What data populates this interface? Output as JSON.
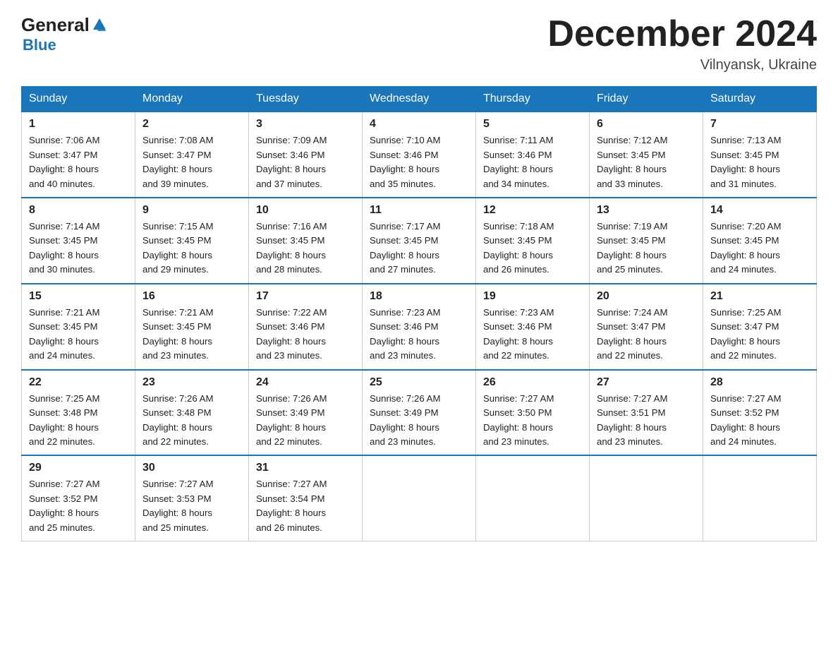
{
  "header": {
    "logo_general": "General",
    "logo_blue": "Blue",
    "month_title": "December 2024",
    "location": "Vilnyansk, Ukraine"
  },
  "days_of_week": [
    "Sunday",
    "Monday",
    "Tuesday",
    "Wednesday",
    "Thursday",
    "Friday",
    "Saturday"
  ],
  "weeks": [
    [
      {
        "day": "1",
        "sunrise": "Sunrise: 7:06 AM",
        "sunset": "Sunset: 3:47 PM",
        "daylight": "Daylight: 8 hours",
        "minutes": "and 40 minutes."
      },
      {
        "day": "2",
        "sunrise": "Sunrise: 7:08 AM",
        "sunset": "Sunset: 3:47 PM",
        "daylight": "Daylight: 8 hours",
        "minutes": "and 39 minutes."
      },
      {
        "day": "3",
        "sunrise": "Sunrise: 7:09 AM",
        "sunset": "Sunset: 3:46 PM",
        "daylight": "Daylight: 8 hours",
        "minutes": "and 37 minutes."
      },
      {
        "day": "4",
        "sunrise": "Sunrise: 7:10 AM",
        "sunset": "Sunset: 3:46 PM",
        "daylight": "Daylight: 8 hours",
        "minutes": "and 35 minutes."
      },
      {
        "day": "5",
        "sunrise": "Sunrise: 7:11 AM",
        "sunset": "Sunset: 3:46 PM",
        "daylight": "Daylight: 8 hours",
        "minutes": "and 34 minutes."
      },
      {
        "day": "6",
        "sunrise": "Sunrise: 7:12 AM",
        "sunset": "Sunset: 3:45 PM",
        "daylight": "Daylight: 8 hours",
        "minutes": "and 33 minutes."
      },
      {
        "day": "7",
        "sunrise": "Sunrise: 7:13 AM",
        "sunset": "Sunset: 3:45 PM",
        "daylight": "Daylight: 8 hours",
        "minutes": "and 31 minutes."
      }
    ],
    [
      {
        "day": "8",
        "sunrise": "Sunrise: 7:14 AM",
        "sunset": "Sunset: 3:45 PM",
        "daylight": "Daylight: 8 hours",
        "minutes": "and 30 minutes."
      },
      {
        "day": "9",
        "sunrise": "Sunrise: 7:15 AM",
        "sunset": "Sunset: 3:45 PM",
        "daylight": "Daylight: 8 hours",
        "minutes": "and 29 minutes."
      },
      {
        "day": "10",
        "sunrise": "Sunrise: 7:16 AM",
        "sunset": "Sunset: 3:45 PM",
        "daylight": "Daylight: 8 hours",
        "minutes": "and 28 minutes."
      },
      {
        "day": "11",
        "sunrise": "Sunrise: 7:17 AM",
        "sunset": "Sunset: 3:45 PM",
        "daylight": "Daylight: 8 hours",
        "minutes": "and 27 minutes."
      },
      {
        "day": "12",
        "sunrise": "Sunrise: 7:18 AM",
        "sunset": "Sunset: 3:45 PM",
        "daylight": "Daylight: 8 hours",
        "minutes": "and 26 minutes."
      },
      {
        "day": "13",
        "sunrise": "Sunrise: 7:19 AM",
        "sunset": "Sunset: 3:45 PM",
        "daylight": "Daylight: 8 hours",
        "minutes": "and 25 minutes."
      },
      {
        "day": "14",
        "sunrise": "Sunrise: 7:20 AM",
        "sunset": "Sunset: 3:45 PM",
        "daylight": "Daylight: 8 hours",
        "minutes": "and 24 minutes."
      }
    ],
    [
      {
        "day": "15",
        "sunrise": "Sunrise: 7:21 AM",
        "sunset": "Sunset: 3:45 PM",
        "daylight": "Daylight: 8 hours",
        "minutes": "and 24 minutes."
      },
      {
        "day": "16",
        "sunrise": "Sunrise: 7:21 AM",
        "sunset": "Sunset: 3:45 PM",
        "daylight": "Daylight: 8 hours",
        "minutes": "and 23 minutes."
      },
      {
        "day": "17",
        "sunrise": "Sunrise: 7:22 AM",
        "sunset": "Sunset: 3:46 PM",
        "daylight": "Daylight: 8 hours",
        "minutes": "and 23 minutes."
      },
      {
        "day": "18",
        "sunrise": "Sunrise: 7:23 AM",
        "sunset": "Sunset: 3:46 PM",
        "daylight": "Daylight: 8 hours",
        "minutes": "and 23 minutes."
      },
      {
        "day": "19",
        "sunrise": "Sunrise: 7:23 AM",
        "sunset": "Sunset: 3:46 PM",
        "daylight": "Daylight: 8 hours",
        "minutes": "and 22 minutes."
      },
      {
        "day": "20",
        "sunrise": "Sunrise: 7:24 AM",
        "sunset": "Sunset: 3:47 PM",
        "daylight": "Daylight: 8 hours",
        "minutes": "and 22 minutes."
      },
      {
        "day": "21",
        "sunrise": "Sunrise: 7:25 AM",
        "sunset": "Sunset: 3:47 PM",
        "daylight": "Daylight: 8 hours",
        "minutes": "and 22 minutes."
      }
    ],
    [
      {
        "day": "22",
        "sunrise": "Sunrise: 7:25 AM",
        "sunset": "Sunset: 3:48 PM",
        "daylight": "Daylight: 8 hours",
        "minutes": "and 22 minutes."
      },
      {
        "day": "23",
        "sunrise": "Sunrise: 7:26 AM",
        "sunset": "Sunset: 3:48 PM",
        "daylight": "Daylight: 8 hours",
        "minutes": "and 22 minutes."
      },
      {
        "day": "24",
        "sunrise": "Sunrise: 7:26 AM",
        "sunset": "Sunset: 3:49 PM",
        "daylight": "Daylight: 8 hours",
        "minutes": "and 22 minutes."
      },
      {
        "day": "25",
        "sunrise": "Sunrise: 7:26 AM",
        "sunset": "Sunset: 3:49 PM",
        "daylight": "Daylight: 8 hours",
        "minutes": "and 23 minutes."
      },
      {
        "day": "26",
        "sunrise": "Sunrise: 7:27 AM",
        "sunset": "Sunset: 3:50 PM",
        "daylight": "Daylight: 8 hours",
        "minutes": "and 23 minutes."
      },
      {
        "day": "27",
        "sunrise": "Sunrise: 7:27 AM",
        "sunset": "Sunset: 3:51 PM",
        "daylight": "Daylight: 8 hours",
        "minutes": "and 23 minutes."
      },
      {
        "day": "28",
        "sunrise": "Sunrise: 7:27 AM",
        "sunset": "Sunset: 3:52 PM",
        "daylight": "Daylight: 8 hours",
        "minutes": "and 24 minutes."
      }
    ],
    [
      {
        "day": "29",
        "sunrise": "Sunrise: 7:27 AM",
        "sunset": "Sunset: 3:52 PM",
        "daylight": "Daylight: 8 hours",
        "minutes": "and 25 minutes."
      },
      {
        "day": "30",
        "sunrise": "Sunrise: 7:27 AM",
        "sunset": "Sunset: 3:53 PM",
        "daylight": "Daylight: 8 hours",
        "minutes": "and 25 minutes."
      },
      {
        "day": "31",
        "sunrise": "Sunrise: 7:27 AM",
        "sunset": "Sunset: 3:54 PM",
        "daylight": "Daylight: 8 hours",
        "minutes": "and 26 minutes."
      },
      null,
      null,
      null,
      null
    ]
  ]
}
